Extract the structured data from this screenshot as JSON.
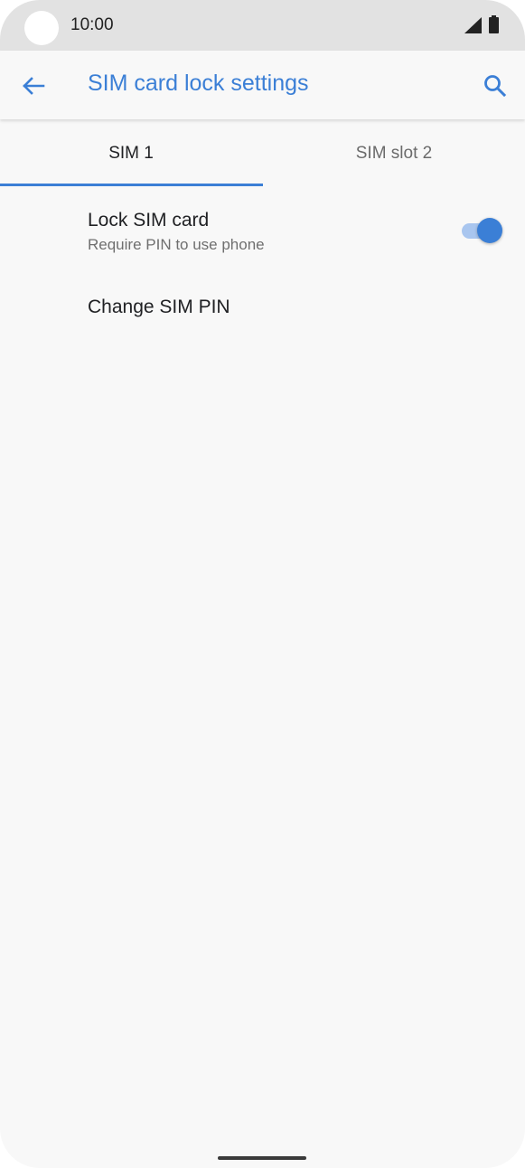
{
  "status_bar": {
    "time": "10:00",
    "icons": [
      "signal-icon",
      "battery-icon"
    ]
  },
  "app_bar": {
    "title": "SIM card lock settings",
    "back_icon": "arrow-left-icon",
    "search_icon": "search-icon"
  },
  "tabs": [
    {
      "label": "SIM 1",
      "selected": true
    },
    {
      "label": "SIM slot 2",
      "selected": false
    }
  ],
  "settings": {
    "lock_sim": {
      "title": "Lock SIM card",
      "summary": "Require PIN to use phone",
      "enabled": true
    },
    "change_pin": {
      "title": "Change SIM PIN"
    }
  },
  "colors": {
    "accent": "#3b7fd6",
    "background": "#f8f8f8",
    "status_bar": "#e2e2e2"
  }
}
